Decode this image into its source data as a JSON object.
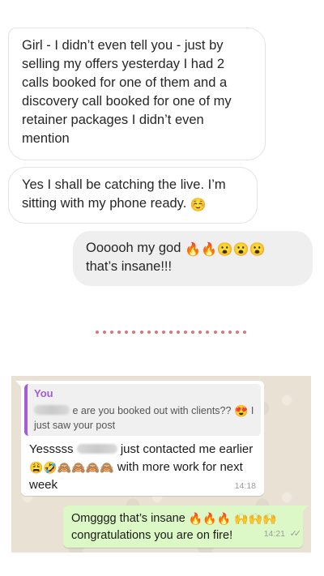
{
  "instagram": {
    "bubble1": "Girl - I didn’t even tell you - just by selling my offers  yesterday I had 2 calls booked for one of them and a discovery call booked for one of my retainer packages I didn’t even mention",
    "bubble2_text": "Yes I shall be catching the live. I’m sitting with my phone ready.",
    "bubble2_emoji": "☺️",
    "bubble3_line1_text": "Oooooh my god",
    "bubble3_line1_emoji": "🔥🔥😮😮😮",
    "bubble3_line2": "that’s insane!!!"
  },
  "whatsapp": {
    "quote_name": "You",
    "quote_prefix": "",
    "quote_text": "e are you booked out with clients??",
    "quote_emoji": "😍",
    "quote_text2": "I just saw your post",
    "reply_prefix": "Yesssss",
    "reply_text": "just contacted me earlier",
    "reply_emoji": "😩🤣🙈🙈🙈🙈",
    "reply_text2": "with more work for next week",
    "reply_time": "14:18",
    "sent_text": "Omgggg that’s insane",
    "sent_emoji": "🔥🔥🔥",
    "sent_emoji2": "🙌🙌🙌",
    "sent_text2": "congratulations you are on fire!",
    "sent_time": "14:21",
    "sent_ticks": "✓✓"
  }
}
